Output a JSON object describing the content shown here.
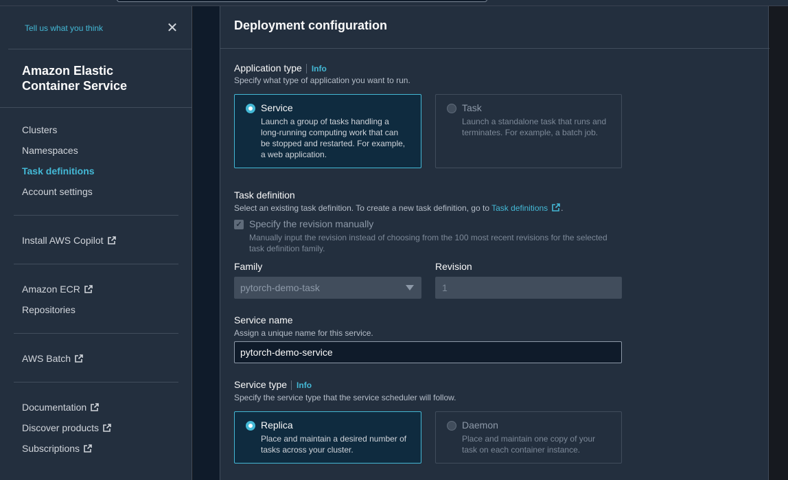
{
  "sidebar": {
    "feedback_link": "Tell us what you think",
    "service_title": "Amazon Elastic Container Service",
    "nav_primary": [
      "Clusters",
      "Namespaces",
      "Task definitions",
      "Account settings"
    ],
    "active_item": "Task definitions",
    "links": {
      "copilot": "Install AWS Copilot",
      "ecr": "Amazon ECR",
      "repositories": "Repositories",
      "batch": "AWS Batch",
      "documentation": "Documentation",
      "discover": "Discover products",
      "subscriptions": "Subscriptions"
    }
  },
  "panel": {
    "title": "Deployment configuration",
    "application_type": {
      "label": "Application type",
      "info": "Info",
      "description": "Specify what type of application you want to run.",
      "options": [
        {
          "title": "Service",
          "description_lines": [
            "Launch a group of tasks handling a",
            "long-running computing work that can",
            "be stopped and restarted. For example,",
            "a web application."
          ],
          "selected": true
        },
        {
          "title": "Task",
          "description_lines": [
            "Launch a standalone task that runs and",
            "terminates. For example, a batch job."
          ],
          "selected": false
        }
      ]
    },
    "task_definition": {
      "label": "Task definition",
      "description": "Select an existing task definition. To create a new task definition, go to ",
      "link": "Task definitions",
      "description_end": ".",
      "checkbox_label": "Specify the revision manually",
      "checkbox_checked": true,
      "checkbox_desc_lines": [
        "Manually input the revision instead of choosing from the 100 most recent revisions for the selected",
        "task definition family."
      ],
      "family_label": "Family",
      "family_value": "pytorch-demo-task",
      "revision_label": "Revision",
      "revision_value": "1"
    },
    "service_name": {
      "label": "Service name",
      "description": "Assign a unique name for this service.",
      "value": "pytorch-demo-service"
    },
    "service_type": {
      "label": "Service type",
      "info": "Info",
      "description": "Specify the service type that the service scheduler will follow.",
      "options": [
        {
          "title": "Replica",
          "description_lines": [
            "Place and maintain a desired number of",
            "tasks across your cluster."
          ],
          "selected": true
        },
        {
          "title": "Daemon",
          "description_lines": [
            "Place and maintain one copy of your",
            "task on each container instance."
          ],
          "selected": false
        }
      ]
    }
  },
  "colors": {
    "accent": "#44b9d6",
    "sidebar_bg": "#232f3e",
    "page_bg": "#16191f"
  },
  "icons": {
    "close": "close-icon",
    "external": "external-link-icon",
    "dropdown": "caret-down-icon"
  }
}
